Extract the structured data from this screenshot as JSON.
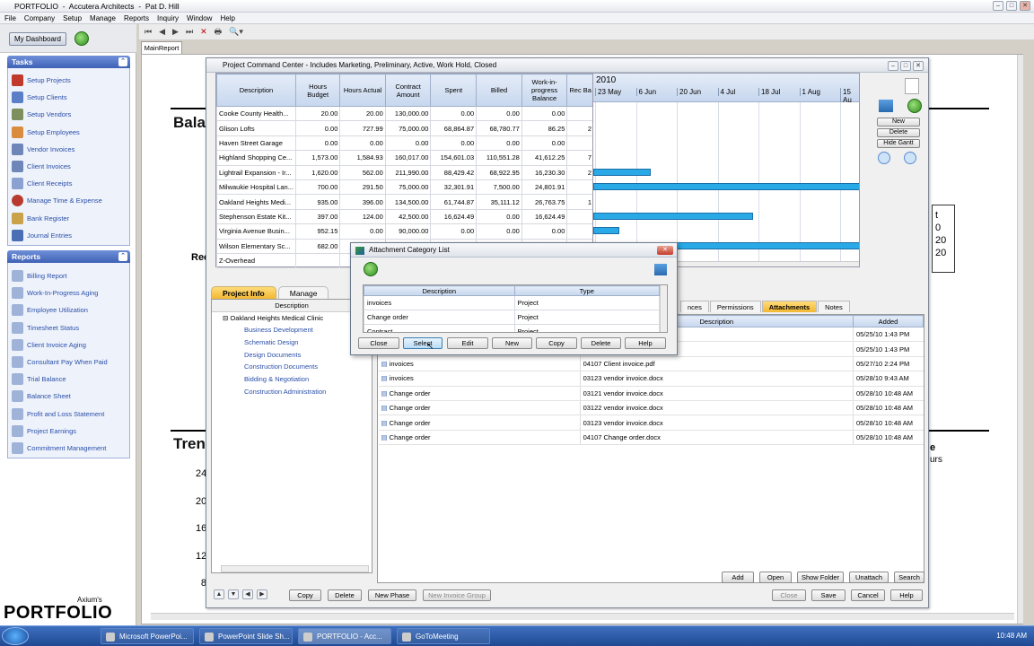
{
  "app": {
    "title": "PORTFOLIO",
    "company": "Accutera Architects",
    "user": "Pat D. Hill"
  },
  "menu": [
    "File",
    "Company",
    "Setup",
    "Manage",
    "Reports",
    "Inquiry",
    "Window",
    "Help"
  ],
  "dashboard": {
    "label": "My Dashboard"
  },
  "tasks": {
    "title": "Tasks",
    "items": [
      "Setup Projects",
      "Setup Clients",
      "Setup Vendors",
      "Setup Employees",
      "Vendor Invoices",
      "Client Invoices",
      "Client Receipts",
      "Manage Time & Expense",
      "Bank Register",
      "Journal Entries"
    ]
  },
  "reports": {
    "title": "Reports",
    "items": [
      "Billing Report",
      "Work-In-Progress Aging",
      "Employee Utilization",
      "Timesheet Status",
      "Client Invoice Aging",
      "Consultant Pay When Paid",
      "Trial Balance",
      "Balance Sheet",
      "Profit and Loss Statement",
      "Project Earnings",
      "Commitment Management"
    ]
  },
  "logo": {
    "brand": "Axium's",
    "name": "PORTFOLIO"
  },
  "main_tab": "MainReport",
  "background_report": {
    "bala": "Bala",
    "tren": "Tren",
    "rec": "Rec",
    "nums": [
      "24",
      "20",
      "16",
      "12",
      "8"
    ],
    "right_lines": [
      "t",
      "0",
      "20",
      "20"
    ],
    "right2": [
      "e",
      "urs"
    ]
  },
  "pcc": {
    "title": "Project Command Center - Includes Marketing, Preliminary, Active, Work Hold, Closed",
    "columns": [
      "Description",
      "Hours Budget",
      "Hours Actual",
      "Contract Amount",
      "Spent",
      "Billed",
      "Work-in-progress Balance",
      "Rec Ba"
    ],
    "rows": [
      [
        "Cooke County Health...",
        "20.00",
        "20.00",
        "130,000.00",
        "0.00",
        "0.00",
        "0.00",
        ""
      ],
      [
        "Glison Lofts",
        "0.00",
        "727.99",
        "75,000.00",
        "68,864.87",
        "68,780.77",
        "86.25",
        "2"
      ],
      [
        "Haven Street Garage",
        "0.00",
        "0.00",
        "0.00",
        "0.00",
        "0.00",
        "0.00",
        ""
      ],
      [
        "Highland Shopping Ce...",
        "1,573.00",
        "1,584.93",
        "160,017.00",
        "154,601.03",
        "110,551.28",
        "41,612.25",
        "7"
      ],
      [
        "Lightrail Expansion - Ir...",
        "1,620.00",
        "562.00",
        "211,990.00",
        "88,429.42",
        "68,922.95",
        "16,230.30",
        "2"
      ],
      [
        "Milwaukie Hospital Lan...",
        "700.00",
        "291.50",
        "75,000.00",
        "32,301.91",
        "7,500.00",
        "24,801.91",
        ""
      ],
      [
        "Oakland Heights Medi...",
        "935.00",
        "396.00",
        "134,500.00",
        "61,744.87",
        "35,111.12",
        "26,763.75",
        "1"
      ],
      [
        "Stephenson Estate Kit...",
        "397.00",
        "124.00",
        "42,500.00",
        "16,624.49",
        "0.00",
        "16,624.49",
        ""
      ],
      [
        "Virginia Avenue Busin...",
        "952.15",
        "0.00",
        "90,000.00",
        "0.00",
        "0.00",
        "0.00",
        ""
      ],
      [
        "Wilson Elementary Sc...",
        "682.00",
        "",
        "",
        "",
        "",
        "",
        ""
      ],
      [
        "Z-Overhead",
        "",
        "",
        "",
        "",
        "",
        "",
        ""
      ]
    ],
    "gantt": {
      "year": "2010",
      "dates": [
        "23 May",
        "6 Jun",
        "20 Jun",
        "4 Jul",
        "18 Jul",
        "1 Aug",
        "15 Au"
      ]
    },
    "side_buttons": [
      "New",
      "Delete",
      "Hide Gantt"
    ],
    "tabs": [
      "Project Info",
      "Manage"
    ],
    "tree": {
      "header": "Description",
      "items": [
        "Oakland Heights Medical Clinic",
        "Business Development",
        "Schematic Design",
        "Design Documents",
        "Construction Documents",
        "Bidding & Negotiation",
        "Construction Administration"
      ]
    },
    "bottom_left_buttons": [
      "Copy",
      "Delete",
      "New Phase",
      "New Invoice Group"
    ],
    "att_tabs": [
      "nces",
      "Permissions",
      "Attachments",
      "Notes"
    ],
    "att_columns": [
      "Description",
      "Added"
    ],
    "att_rows": [
      [
        "",
        "",
        "05/25/10 1:43 PM"
      ],
      [
        "",
        "",
        "05/25/10 1:43 PM"
      ],
      [
        "invoices",
        "04107 Client invoice.pdf",
        "05/27/10 2:24 PM"
      ],
      [
        "invoices",
        "03123 vendor invoice.docx",
        "05/28/10 9:43 AM"
      ],
      [
        "Change order",
        "03121 vendor invoice.docx",
        "05/28/10 10:48 AM"
      ],
      [
        "Change order",
        "03122 vendor invoice.docx",
        "05/28/10 10:48 AM"
      ],
      [
        "Change order",
        "03123 vendor invoice.docx",
        "05/28/10 10:48 AM"
      ],
      [
        "Change order",
        "04107 Change order.docx",
        "05/28/10 10:48 AM"
      ]
    ],
    "att_buttons": [
      "Add",
      "Open",
      "Show Folder",
      "Unattach",
      "Search"
    ],
    "bottom_buttons": [
      "Close",
      "Save",
      "Cancel",
      "Help"
    ]
  },
  "dialog": {
    "title": "Attachment Category List",
    "columns": [
      "Description",
      "Type"
    ],
    "rows": [
      [
        "invoices",
        "Project"
      ],
      [
        "Change order",
        "Project"
      ],
      [
        "Contract",
        "Project"
      ]
    ],
    "buttons": [
      "Close",
      "Select",
      "Edit",
      "New",
      "Copy",
      "Delete",
      "Help"
    ]
  },
  "taskbar": {
    "items": [
      "Microsoft PowerPoi...",
      "PowerPoint Slide Sh...",
      "PORTFOLIO - Acc...",
      "GoToMeeting"
    ],
    "clock": "10:48 AM"
  }
}
